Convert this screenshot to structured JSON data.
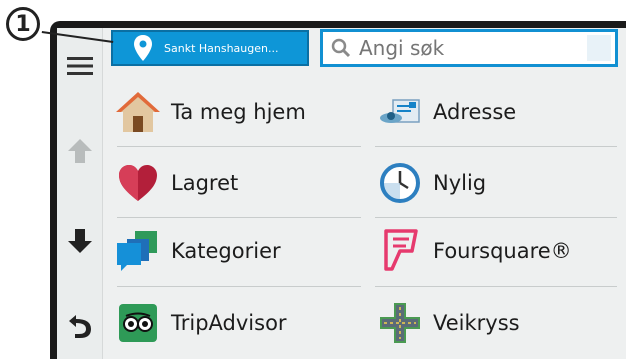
{
  "callout": {
    "label": "1"
  },
  "location_button": {
    "label": "Sankt Hanshaugen..."
  },
  "search": {
    "placeholder": "Angi søk",
    "value": ""
  },
  "left_nav": {
    "menu_icon": "hamburger-menu-icon",
    "up_icon": "arrow-up-icon",
    "down_icon": "arrow-down-icon",
    "back_icon": "back-arrow-icon"
  },
  "tiles": [
    {
      "label": "Ta meg hjem",
      "icon": "home-icon"
    },
    {
      "label": "Adresse",
      "icon": "address-icon"
    },
    {
      "label": "Lagret",
      "icon": "heart-icon"
    },
    {
      "label": "Nylig",
      "icon": "clock-icon"
    },
    {
      "label": "Kategorier",
      "icon": "categories-icon"
    },
    {
      "label": "Foursquare®",
      "icon": "foursquare-icon"
    },
    {
      "label": "TripAdvisor",
      "icon": "tripadvisor-icon"
    },
    {
      "label": "Veikryss",
      "icon": "intersection-icon"
    }
  ],
  "colors": {
    "accent": "#0e96d7",
    "search_border": "#1190d2",
    "screen_bg": "#eef0f0"
  }
}
